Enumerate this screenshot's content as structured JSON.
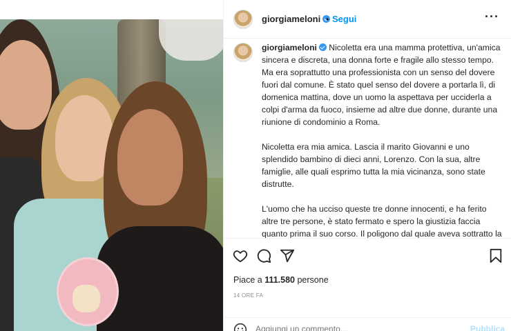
{
  "post": {
    "username": "giorgiameloni",
    "follow_label": "Segui",
    "separator": "•",
    "more_label": "···",
    "caption_paragraphs": [
      "Nicoletta era una mamma protettiva, un'amica sincera e discreta, una donna forte e fragile allo stesso tempo.\nMa era soprattutto una professionista con un senso del dovere fuori dal comune. È stato quel senso del dovere a portarla lì, di domenica mattina, dove un uomo la aspettava per ucciderla a colpi d'arma da fuoco, insieme ad altre due donne, durante una riunione di condominio a Roma.",
      "Nicoletta era mia amica. Lascia il marito Giovanni e uno splendido bambino di dieci anni, Lorenzo. Con la sua, altre famiglie, alle quali esprimo tutta la mia vicinanza, sono state distrutte.",
      "L'uomo che ha ucciso queste tre donne innocenti, e ha ferito altre tre persone, è stato fermato e spero la giustizia faccia quanto prima il suo corso. Il poligono dal quale aveva sottratto la"
    ],
    "likes_prefix": "Piace a",
    "likes_count": "111.580",
    "likes_suffix": "persone",
    "timestamp": "14 ORE FA",
    "comment_placeholder": "Aggiungi un commento...",
    "publish_label": "Pubblica"
  },
  "icons": {
    "verified": "verified-badge-icon",
    "like": "heart-icon",
    "comment": "comment-icon",
    "share": "paper-plane-icon",
    "save": "bookmark-icon",
    "emoji": "smiley-icon"
  },
  "colors": {
    "link_blue": "#0095f6",
    "verified_blue": "#3897f0",
    "muted_text": "#8e8e8e",
    "publish_disabled": "#b2dffc"
  }
}
